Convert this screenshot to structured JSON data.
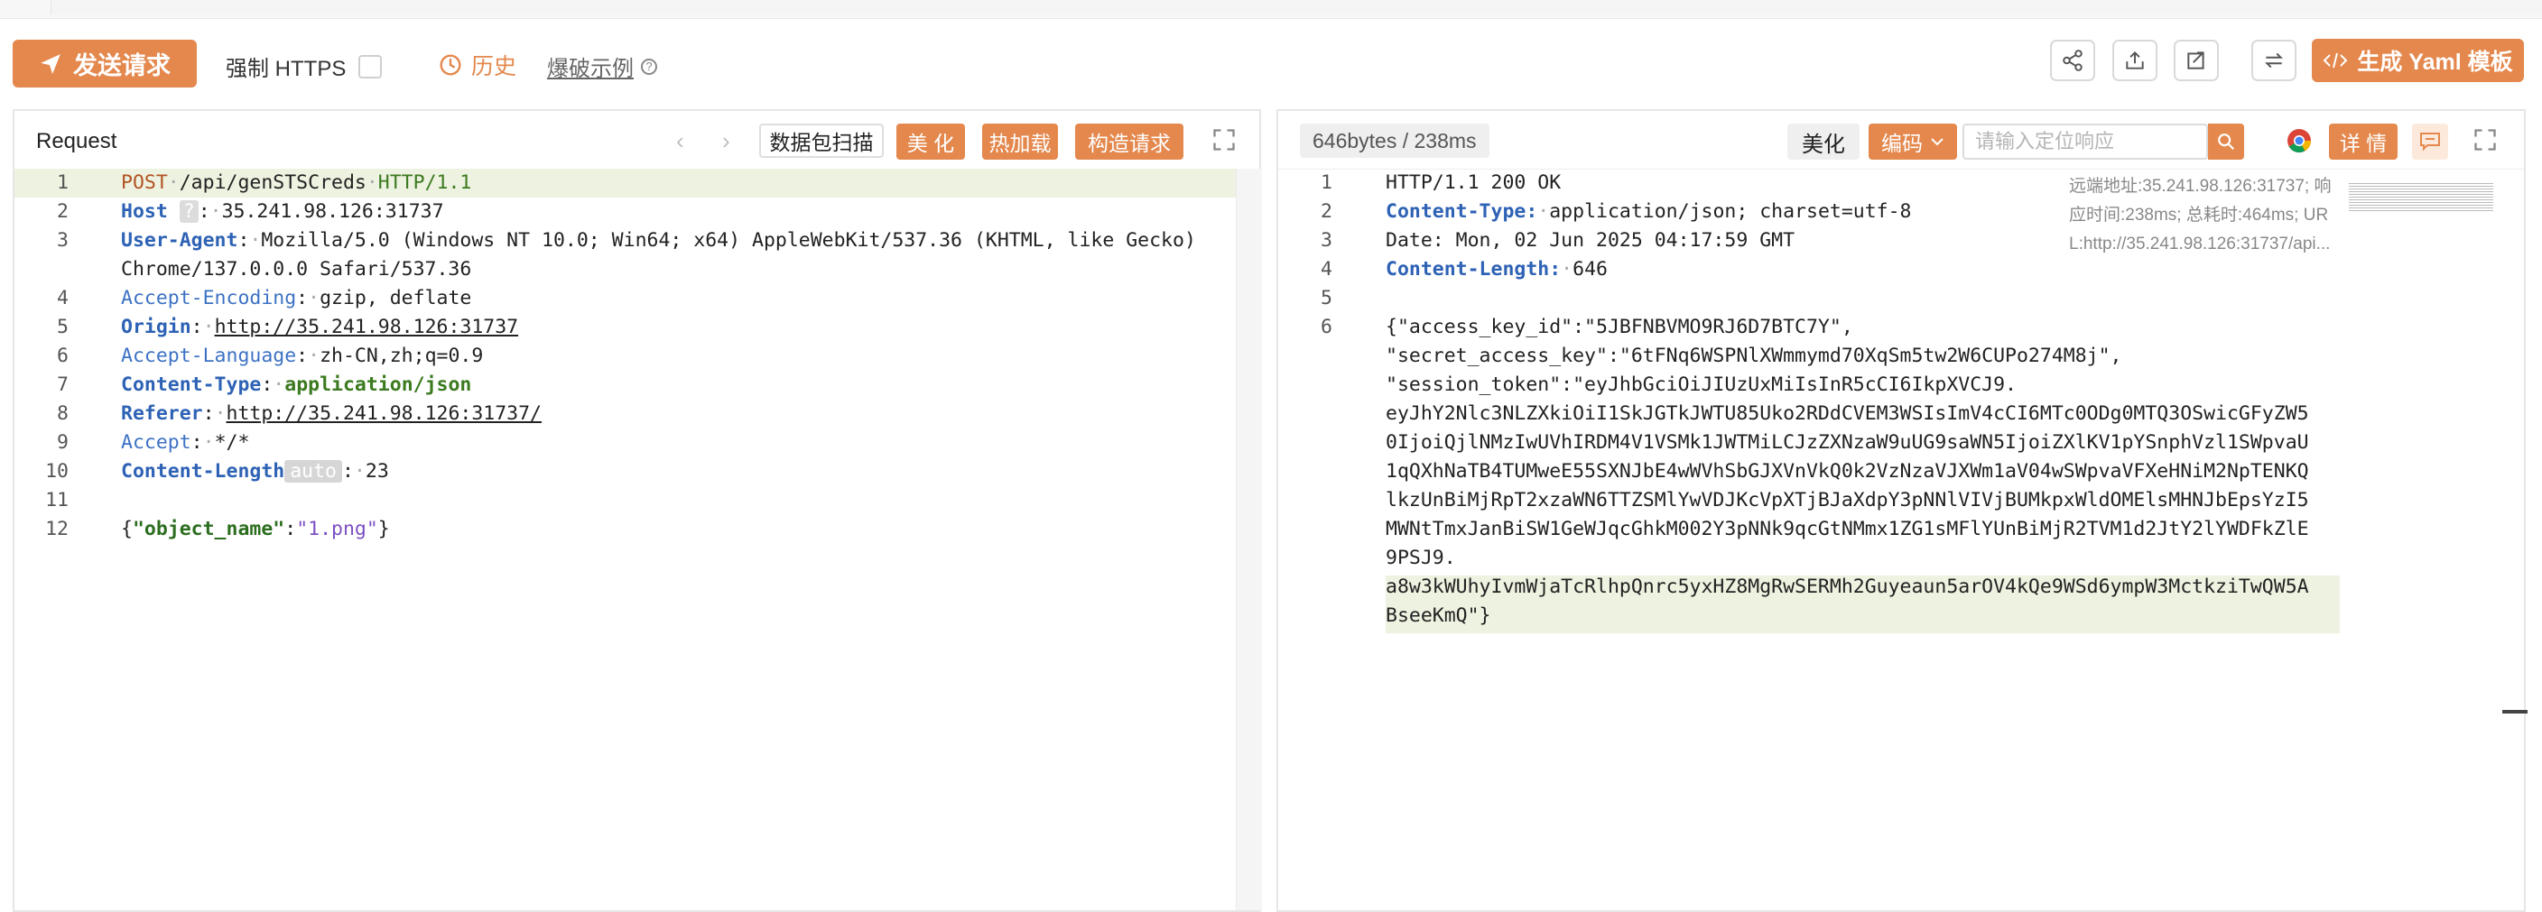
{
  "toolbar": {
    "send_label": "发送请求",
    "force_https_label": "强制 HTTPS",
    "history_label": "历史",
    "burst_example_label": "爆破示例",
    "yaml_label": "生成 Yaml 模板"
  },
  "request": {
    "title": "Request",
    "scan_label": "数据包扫描",
    "beautify_label": "美 化",
    "hot_reload_label": "热加载",
    "build_label": "构造请求"
  },
  "response": {
    "stats": "646bytes / 238ms",
    "beautify_label": "美化",
    "encode_label": "编码",
    "search_placeholder": "请输入定位响应",
    "detail_label": "详 情",
    "meta": {
      "remote": "远端地址:35.241.98.126:31737; 响",
      "timing": "应时间:238ms; 总耗时:464ms; UR",
      "url": "L:http://35.241.98.126:31737/api..."
    }
  },
  "req_lines": [
    {
      "n": "1"
    },
    {
      "n": "2"
    },
    {
      "n": "3"
    },
    {
      "n": "4"
    },
    {
      "n": "5"
    },
    {
      "n": "6"
    },
    {
      "n": "7"
    },
    {
      "n": "8"
    },
    {
      "n": "9"
    },
    {
      "n": "10"
    },
    {
      "n": "11"
    },
    {
      "n": "12"
    }
  ],
  "req": {
    "l1_method": "POST",
    "l1_path": "/api/genSTSCreds",
    "l1_proto": "HTTP/1.1",
    "l2_key": "Host",
    "l2_badge": "?",
    "l2_val": "35.241.98.126:31737",
    "l3_key": "User-Agent",
    "l3_val": "Mozilla/5.0 (Windows NT 10.0; Win64; x64) AppleWebKit/537.36 (KHTML, like Gecko)",
    "l3_val2": "Chrome/137.0.0.0 Safari/537.36",
    "l4_key": "Accept-Encoding",
    "l4_val": "gzip, deflate",
    "l5_key": "Origin",
    "l5_val": "http://35.241.98.126:31737",
    "l6_key": "Accept-Language",
    "l6_val": "zh-CN,zh;q=0.9",
    "l7_key": "Content-Type",
    "l7_val": "application/json",
    "l8_key": "Referer",
    "l8_val": "http://35.241.98.126:31737/",
    "l9_key": "Accept",
    "l9_val": "*/*",
    "l10_key": "Content-Length",
    "l10_badge": "auto",
    "l10_val": "23",
    "l12_k": "\"object_name\"",
    "l12_v": "\"1.png\""
  },
  "resp_lines": [
    {
      "n": "1"
    },
    {
      "n": "2"
    },
    {
      "n": "3"
    },
    {
      "n": "4"
    },
    {
      "n": "5"
    },
    {
      "n": "6"
    }
  ],
  "resp": {
    "l1": "HTTP/1.1 200 OK",
    "l2_key": "Content-Type:",
    "l2_val": "application/json; charset=utf-8",
    "l3": "Date: Mon, 02 Jun 2025 04:17:59 GMT",
    "l4_key": "Content-Length:",
    "l4_val": "646",
    "l6_a": "{\"access_key_id\":\"5JBFNBVMO9RJ6D7BTC7Y\",",
    "l6_b": "\"secret_access_key\":\"6tFNq6WSPNlXWmmymd70XqSm5tw2W6CUPo274M8j\",",
    "l6_c": "\"session_token\":\"eyJhbGciOiJIUzUxMiIsInR5cCI6IkpXVCJ9.",
    "l6_d": "eyJhY2Nlc3NLZXkiOiI1SkJGTkJWTU85Uko2RDdCVEM3WSIsImV4cCI6MTc0ODg0MTQ3OSwicGFyZW5",
    "l6_e": "0IjoiQjlNMzIwUVhIRDM4V1VSMk1JWTMiLCJzZXNzaW9uUG9saWN5IjoiZXlKV1pYSnphVzl1SWpvaU",
    "l6_f": "1qQXhNaTB4TUMweE55SXNJbE4wWVhSbGJXVnVkQ0k2VzNzaVJXWm1aV04wSWpvaVFXeHNiM2NpTENKQ",
    "l6_g": "lkzUnBiMjRpT2xzaWN6TTZSMlYwVDJKcVpXTjBJaXdpY3pNNlVIVjBUMkpxWldOMElsMHNJbEpsYzI5",
    "l6_h": "MWNtTmxJanBiSW1GeWJqcGhkM002Y3pNNk9qcGtNMmx1ZG1sMFlYUnBiMjR2TVM1d2JtY2lYWDFkZlE",
    "l6_i": "9PSJ9.",
    "l6_j": "a8w3kWUhyIvmWjaTcRlhpQnrc5yxHZ8MgRwSERMh2Guyeaun5arOV4kQe9WSd6ympW3MctkziTwQW5A",
    "l6_k": "BseeKmQ\"}"
  }
}
